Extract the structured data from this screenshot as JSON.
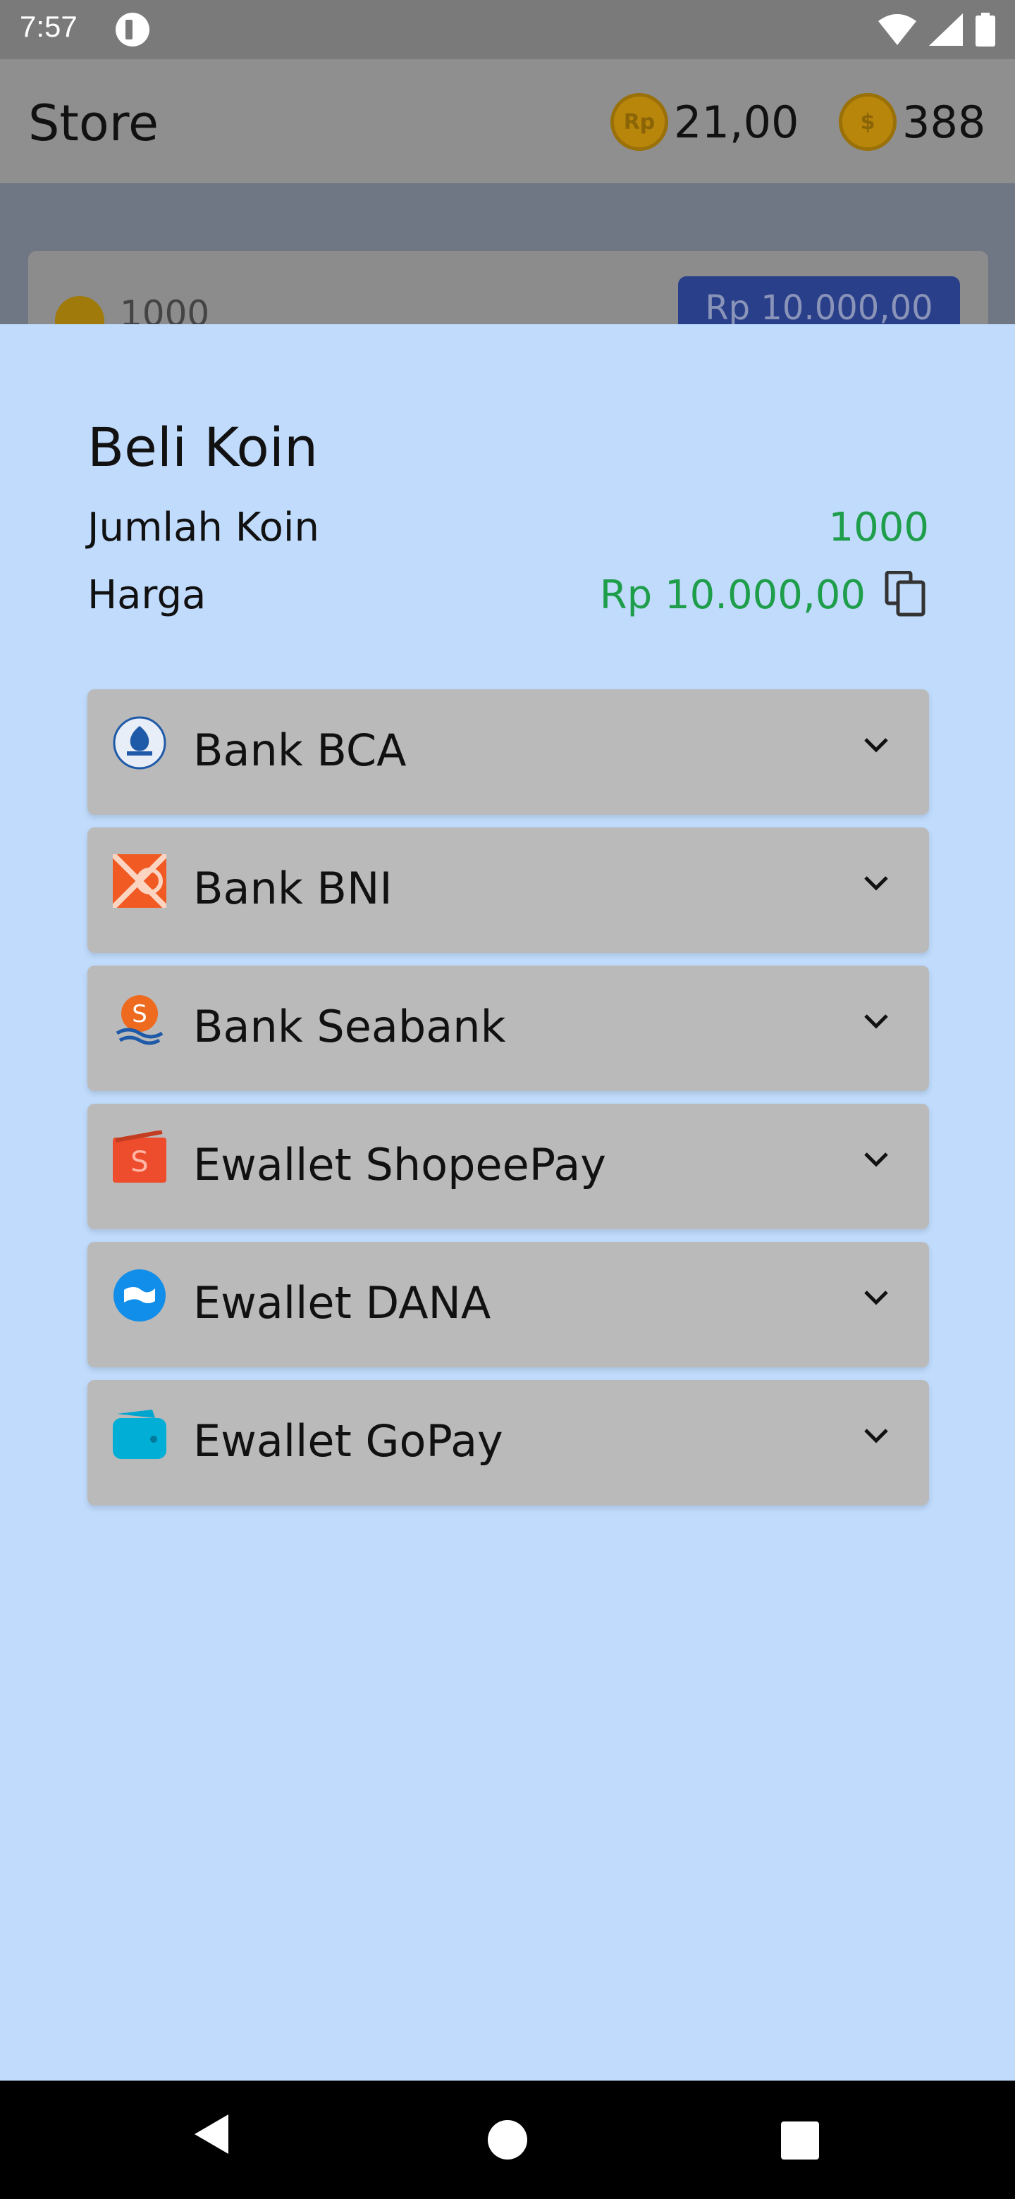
{
  "status_bar": {
    "time": "7:57"
  },
  "header": {
    "title": "Store",
    "rupiah_balance": "21,00",
    "coin_balance": "388",
    "rupiah_coin_label": "Rp",
    "coin_label": "$"
  },
  "behind_list": {
    "amount": "1000",
    "price_button": "Rp 10.000,00"
  },
  "sheet": {
    "title": "Beli Koin",
    "coin_count_label": "Jumlah Koin",
    "coin_count_value": "1000",
    "price_label": "Harga",
    "price_value": "Rp 10.000,00",
    "methods": [
      {
        "label": "Bank BCA",
        "icon": "bca-logo-icon"
      },
      {
        "label": "Bank BNI",
        "icon": "bni-logo-icon"
      },
      {
        "label": "Bank Seabank",
        "icon": "seabank-logo-icon"
      },
      {
        "label": "Ewallet ShopeePay",
        "icon": "shopeepay-logo-icon"
      },
      {
        "label": "Ewallet DANA",
        "icon": "dana-logo-icon"
      },
      {
        "label": "Ewallet GoPay",
        "icon": "gopay-logo-icon"
      }
    ]
  },
  "colors": {
    "sheet_bg": "#c0dbfc",
    "accent_green": "#1e9e4a",
    "method_bg": "#bababa"
  }
}
